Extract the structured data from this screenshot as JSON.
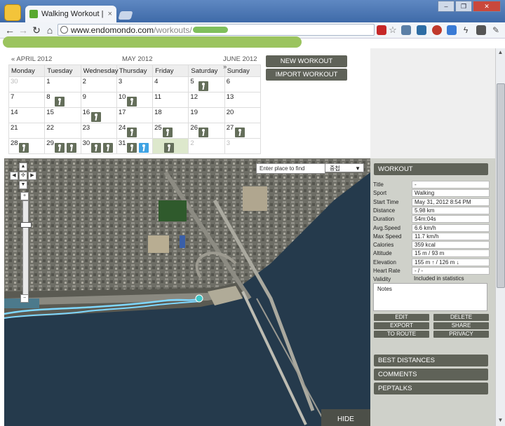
{
  "browser": {
    "tab_title": "Walking Workout | Endom",
    "tab_close": "×",
    "url_domain": "www.endomondo.com",
    "url_path": "/workouts/",
    "window_buttons": [
      "–",
      "❐",
      "✕"
    ]
  },
  "calendar": {
    "prev_month": "« APRIL 2012",
    "current_month": "MAY 2012",
    "next_month": "JUNE 2012 »",
    "days": [
      "Monday",
      "Tuesday",
      "Wednesday",
      "Thursday",
      "Friday",
      "Saturday",
      "Sunday"
    ],
    "weeks": [
      [
        {
          "d": "30",
          "other": true
        },
        {
          "d": "1"
        },
        {
          "d": "2"
        },
        {
          "d": "3"
        },
        {
          "d": "4"
        },
        {
          "d": "5",
          "w": 1
        },
        {
          "d": "6"
        }
      ],
      [
        {
          "d": "7"
        },
        {
          "d": "8",
          "w": 1
        },
        {
          "d": "9"
        },
        {
          "d": "10",
          "w": 1
        },
        {
          "d": "11"
        },
        {
          "d": "12"
        },
        {
          "d": "13"
        }
      ],
      [
        {
          "d": "14"
        },
        {
          "d": "15"
        },
        {
          "d": "16",
          "w": 1
        },
        {
          "d": "17"
        },
        {
          "d": "18"
        },
        {
          "d": "19"
        },
        {
          "d": "20"
        }
      ],
      [
        {
          "d": "21"
        },
        {
          "d": "22"
        },
        {
          "d": "23"
        },
        {
          "d": "24",
          "w": 1
        },
        {
          "d": "25",
          "w": 1
        },
        {
          "d": "26",
          "w": 1
        },
        {
          "d": "27",
          "w": 1
        }
      ],
      [
        {
          "d": "28",
          "w": 1
        },
        {
          "d": "29",
          "w": 2
        },
        {
          "d": "30",
          "w": 2
        },
        {
          "d": "31",
          "w": 2,
          "cur": true
        },
        {
          "d": "",
          "w": 1,
          "sel": true
        },
        {
          "d": "2",
          "other": true
        },
        {
          "d": "3",
          "other": true
        }
      ]
    ]
  },
  "actions": {
    "new_workout": "NEW WORKOUT",
    "import_workout": "IMPORT WORKOUT"
  },
  "map": {
    "search_placeholder": "Enter place to find",
    "type_select": "중첩",
    "hide": "HIDE"
  },
  "workout": {
    "header": "WORKOUT",
    "fields": [
      {
        "label": "Title",
        "value": "-"
      },
      {
        "label": "Sport",
        "value": "Walking"
      },
      {
        "label": "Start Time",
        "value": "May 31, 2012 8:54 PM"
      },
      {
        "label": "Distance",
        "value": "5.98 km"
      },
      {
        "label": "Duration",
        "value": "54m:04s"
      },
      {
        "label": "Avg.Speed",
        "value": "6.6 km/h"
      },
      {
        "label": "Max Speed",
        "value": "11.7 km/h"
      },
      {
        "label": "Calories",
        "value": "359 kcal"
      },
      {
        "label": "Altitude",
        "value": "15 m / 93 m"
      },
      {
        "label": "Elevation",
        "value": "155 m ↑ / 126 m ↓"
      },
      {
        "label": "Heart Rate",
        "value": "- / -"
      },
      {
        "label": "Validity",
        "value": "Included in statistics"
      }
    ],
    "notes_label": "Notes",
    "buttons": {
      "edit": "EDIT",
      "delete": "DELETE",
      "export": "EXPORT",
      "share": "SHARE",
      "to_route": "TO ROUTE",
      "privacy": "PRIVACY"
    },
    "sections": [
      "BEST DISTANCES",
      "COMMENTS",
      "PEPTALKS"
    ]
  },
  "colors": {
    "panel_bg": "#cfd1ca",
    "button_dark": "#5f6258",
    "route": "#7fd8ff",
    "current_workout": "#3fa3e3"
  }
}
